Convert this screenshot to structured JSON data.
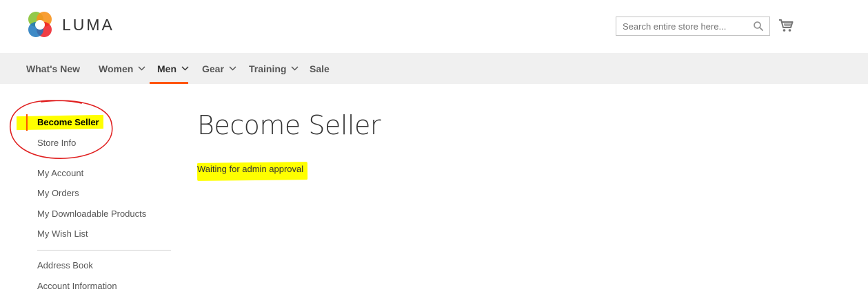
{
  "header": {
    "logo_text": "LUMA",
    "logo_icon": "luma-logo-icon",
    "search": {
      "placeholder": "Search entire store here...",
      "value": ""
    },
    "cart_icon": "cart-icon"
  },
  "nav": {
    "items": [
      {
        "label": "What's New",
        "has_submenu": false
      },
      {
        "label": "Women",
        "has_submenu": true
      },
      {
        "label": "Men",
        "has_submenu": true,
        "active": true
      },
      {
        "label": "Gear",
        "has_submenu": true
      },
      {
        "label": "Training",
        "has_submenu": true
      },
      {
        "label": "Sale",
        "has_submenu": false
      }
    ]
  },
  "sidebar": {
    "marketplace_links": [
      {
        "label": "Become Seller",
        "current": true
      },
      {
        "label": "Store Info"
      }
    ],
    "account_links": [
      {
        "label": "My Account"
      },
      {
        "label": "My Orders"
      },
      {
        "label": "My Downloadable Products"
      },
      {
        "label": "My Wish List"
      }
    ],
    "more_links": [
      {
        "label": "Address Book"
      },
      {
        "label": "Account Information"
      }
    ]
  },
  "main": {
    "page_title": "Become Seller",
    "status_message": "Waiting for admin approval"
  },
  "colors": {
    "accent": "#ff5501",
    "nav_background": "#f0f0f0",
    "highlight": "#ffff00",
    "annotation": "#e02020"
  }
}
